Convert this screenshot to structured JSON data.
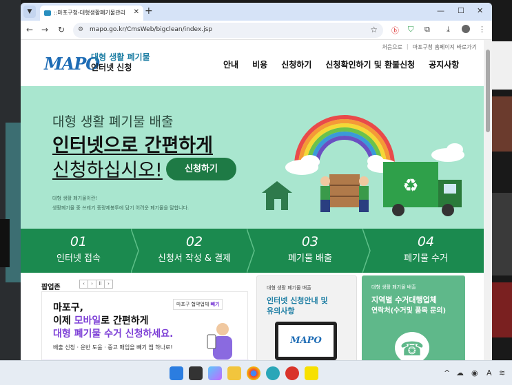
{
  "browser": {
    "tab_title": "::마포구청-대형생활폐기물관리",
    "tab_close": "✕",
    "new_tab": "+",
    "url": "mapo.go.kr/CmsWeb/bigclean/index.jsp"
  },
  "header": {
    "util_links": [
      "처음으로",
      "마포구청 홈페이지 바로가기"
    ],
    "logo_text": "MAPO",
    "logo_sub1": "대형 생활 폐기물",
    "logo_sub2": "인터넷 신청",
    "nav": [
      "안내",
      "비용",
      "신청하기",
      "신청확인하기 및 환불신청",
      "공지사항"
    ]
  },
  "hero": {
    "line1": "대형 생활 폐기물 배출",
    "line2": "인터넷으로 간편하게",
    "line3": "신청하십시오!",
    "apply_button": "신청하기",
    "small1": "대형 생활 폐기물이란!",
    "small2": "생활폐기물 중 쓰레기 종량제봉투에 담기 어려운 폐기물을 말합니다."
  },
  "steps": [
    {
      "num": "01",
      "label": "인터넷 접속"
    },
    {
      "num": "02",
      "label": "신청서 작성 & 결제"
    },
    {
      "num": "03",
      "label": "폐기물 배출"
    },
    {
      "num": "04",
      "label": "폐기물 수거"
    }
  ],
  "popupzone": {
    "label": "팝업존",
    "controls": [
      "‹",
      "›",
      "ll",
      "›"
    ],
    "line1": "마포구,",
    "line2_a": "이제 ",
    "line2_b": "모바일",
    "line2_c": "로 간편하게",
    "line3": "대형 폐기물 수거 신청하세요.",
    "line4": "배출 신청 · 운반 도움 · 중고 매입을 빼기 앱 하나로!",
    "partner_a": "마포구 협약업체 ",
    "partner_b": "빼기"
  },
  "card1": {
    "small": "대형 생활 폐기물 배출",
    "big1": "인터넷 신청안내 및",
    "big2": "유의사항",
    "screen": "MAPO"
  },
  "card2": {
    "small": "대형 생활 폐기물 배출",
    "big1": "지역별 수거대행업체",
    "big2": "연락처(수거및 품목 문의)"
  },
  "colors": {
    "hero_bg": "#a9e6cf",
    "steps_bg": "#1b8a4f",
    "apply_btn": "#1e7a45",
    "accent_purple": "#7d3fd6",
    "card2_bg": "#5fb88a"
  }
}
